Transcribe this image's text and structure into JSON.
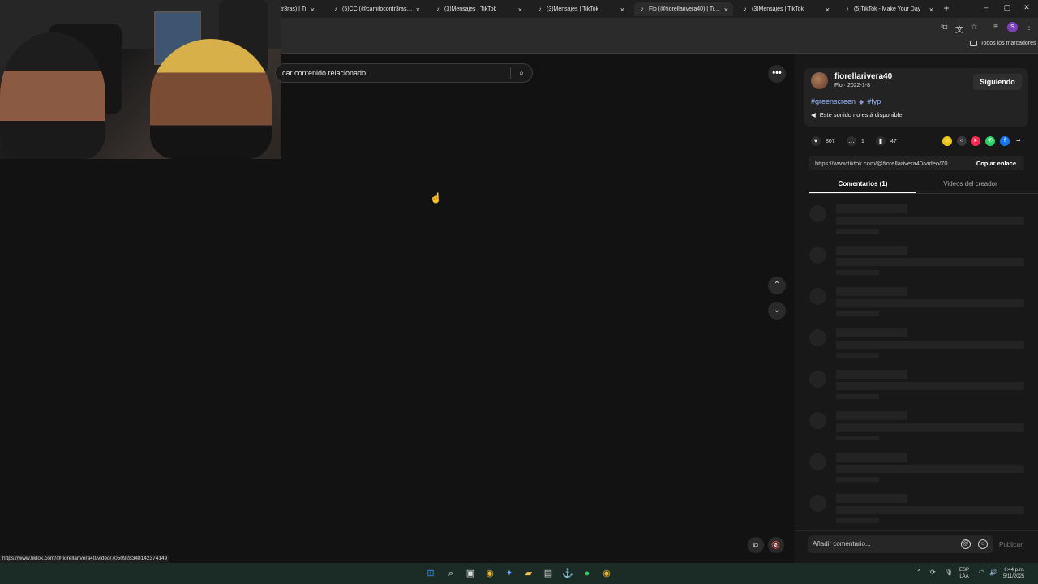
{
  "browser": {
    "tabs": [
      {
        "label": "tr3ras) | Ti",
        "active": false
      },
      {
        "label": "(5)CC (@camilocontr3ras) | Ti",
        "active": false
      },
      {
        "label": "(3)Mensajes | TikTok",
        "active": false
      },
      {
        "label": "(3)Mensajes | TikTok",
        "active": false
      },
      {
        "label": "Flo (@fiorellarivera40) | TikTok",
        "active": true
      },
      {
        "label": "(3)Mensajes | TikTok",
        "active": false
      },
      {
        "label": "(5)TikTok - Make Your Day",
        "active": false
      }
    ],
    "new_tab": "+",
    "bookmarks_all": "Todos los marcadores",
    "profile_initial": "S"
  },
  "main": {
    "search_placeholder": "car contenido relacionado",
    "more": "•••",
    "nav_up": "⌃",
    "nav_down": "⌄",
    "status_url": "https://www.tiktok.com/@fiorellarivera40/video/7050928348142374149"
  },
  "panel": {
    "username": "fiorellarivera40",
    "nickname": "Flo",
    "date": "2022-1-8",
    "follow_label": "Siguiendo",
    "tags": [
      "#greenscreen",
      "#fyp"
    ],
    "sound": "Este sonido no está disponible.",
    "stats": {
      "likes": "807",
      "comments": "1",
      "saves": "47"
    },
    "link_url": "https://www.tiktok.com/@fiorellarivera40/video/70...",
    "copy_label": "Copiar enlace",
    "tab_comments": "Comentarios (1)",
    "tab_creator": "Videos del creador",
    "comment_placeholder": "Añadir comentario...",
    "publish": "Publicar"
  },
  "taskbar": {
    "lang_top": "ESP",
    "lang_bottom": "LAA",
    "time": "6:44 p.m.",
    "date": "5/11/2025"
  },
  "colors": {
    "background": "#121212",
    "panel": "#181818",
    "hashtag": "#8fb7ff",
    "taskbar": "#1b2b26"
  }
}
